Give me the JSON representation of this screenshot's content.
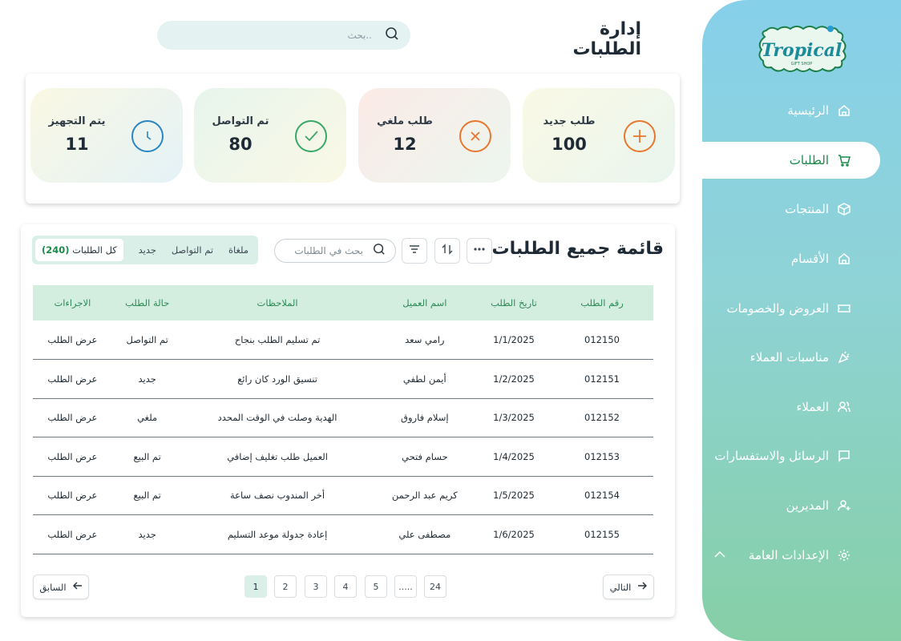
{
  "sidebar": {
    "logo_text": "Tropical",
    "logo_sub": "GIFT SHOP",
    "items": [
      {
        "label": "الرئيسية",
        "icon": "home-icon"
      },
      {
        "label": "الطلبات",
        "icon": "cart-icon"
      },
      {
        "label": "المنتجات",
        "icon": "box-icon"
      },
      {
        "label": "الأقسام",
        "icon": "category-icon"
      },
      {
        "label": "العروض والخصومات",
        "icon": "ticket-icon"
      },
      {
        "label": "مناسبات العملاء",
        "icon": "party-icon"
      },
      {
        "label": "العملاء",
        "icon": "users-icon"
      },
      {
        "label": "الرسائل والاستفسارات",
        "icon": "message-icon"
      },
      {
        "label": "المديرين",
        "icon": "admin-icon"
      },
      {
        "label": "الإعدادات العامة",
        "icon": "gear-icon"
      }
    ]
  },
  "header": {
    "title": "إدارة الطلبات",
    "search_placeholder": "بحث.."
  },
  "stats": [
    {
      "label": "طلب جديد",
      "value": "100",
      "icon": "plus-icon",
      "color": "#e8772e"
    },
    {
      "label": "طلب ملغي",
      "value": "12",
      "icon": "x-icon",
      "color": "#e8772e"
    },
    {
      "label": "تم التواصل",
      "value": "80",
      "icon": "check-icon",
      "color": "#3aa768"
    },
    {
      "label": "يتم التجهيز",
      "value": "11",
      "icon": "clock-icon",
      "color": "#2a86c3"
    }
  ],
  "orders": {
    "title": "قائمة جميع الطلبات",
    "search_placeholder": "بحث في الطلبات",
    "tabs": {
      "all_label": "كل الطلبات",
      "all_count": "(240)",
      "new": "جديد",
      "contacted": "تم التواصل",
      "cancelled": "ملغاة"
    },
    "columns": [
      "رقم الطلب",
      "تاريخ الطلب",
      "اسم العميل",
      "الملاحظات",
      "حالة الطلب",
      "الاجراءات"
    ],
    "rows": [
      {
        "id": "012150",
        "date": "1/1/2025",
        "customer": "رامي سعد",
        "notes": "تم تسليم الطلب بنجاح",
        "status": "تم التواصل",
        "status_type": "contact",
        "action": "عرض الطلب"
      },
      {
        "id": "012151",
        "date": "1/2/2025",
        "customer": "أيمن لطفي",
        "notes": "تنسيق الورد كان رائع",
        "status": "جديد",
        "status_type": "new",
        "action": "عرض الطلب"
      },
      {
        "id": "012152",
        "date": "1/3/2025",
        "customer": "إسلام فاروق",
        "notes": "الهدية وصلت في الوقت المحدد",
        "status": "ملغي",
        "status_type": "cancel",
        "action": "عرض الطلب"
      },
      {
        "id": "012153",
        "date": "1/4/2025",
        "customer": "حسام فتحي",
        "notes": "العميل طلب تغليف إضافي",
        "status": "تم البيع",
        "status_type": "sold",
        "action": "عرض الطلب"
      },
      {
        "id": "012154",
        "date": "1/5/2025",
        "customer": "كريم عبد الرحمن",
        "notes": "أخر المندوب نصف ساعة",
        "status": "تم البيع",
        "status_type": "sold",
        "action": "عرض الطلب"
      },
      {
        "id": "012155",
        "date": "1/6/2025",
        "customer": "مصطفى علي",
        "notes": "إعادة جدولة موعد التسليم",
        "status": "جديد",
        "status_type": "new",
        "action": "عرض الطلب"
      }
    ],
    "pagination": {
      "next": "التالي",
      "prev": "السابق",
      "pages": [
        "24",
        ".....",
        "5",
        "4",
        "3",
        "2",
        "1"
      ],
      "current": "1"
    }
  }
}
